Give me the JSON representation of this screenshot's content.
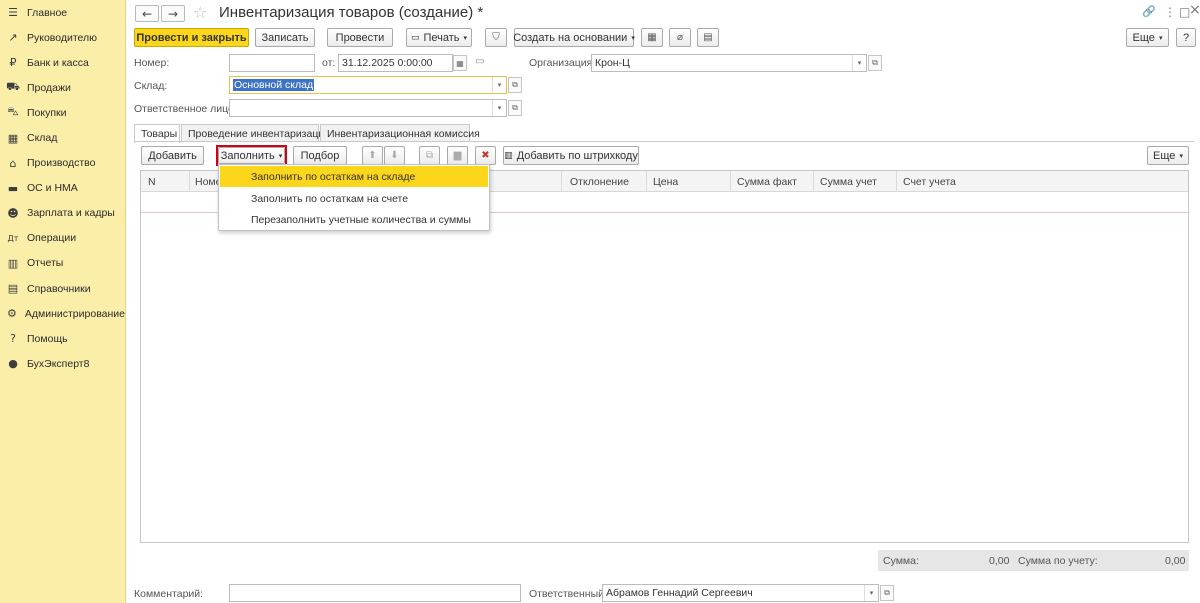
{
  "sidebar": {
    "items": [
      {
        "icon": "menu-icon",
        "glyph": "☰",
        "label": "Главное"
      },
      {
        "icon": "trend-icon",
        "glyph": "↗",
        "label": "Руководителю"
      },
      {
        "icon": "bank-icon",
        "glyph": "₽",
        "label": "Банк и касса"
      },
      {
        "icon": "cart-icon",
        "glyph": "⛟",
        "label": "Продажи"
      },
      {
        "icon": "basket-icon",
        "glyph": "⛍",
        "label": "Покупки"
      },
      {
        "icon": "warehouse-icon",
        "glyph": "▦",
        "label": "Склад"
      },
      {
        "icon": "factory-icon",
        "glyph": "⌂",
        "label": "Производство"
      },
      {
        "icon": "truck-icon",
        "glyph": "▬",
        "label": "ОС и НМА"
      },
      {
        "icon": "people-icon",
        "glyph": "☻",
        "label": "Зарплата и кадры"
      },
      {
        "icon": "operations-icon",
        "glyph": "Дт",
        "label": "Операции"
      },
      {
        "icon": "reports-icon",
        "glyph": "▥",
        "label": "Отчеты"
      },
      {
        "icon": "book-icon",
        "glyph": "▤",
        "label": "Справочники"
      },
      {
        "icon": "gear-icon",
        "glyph": "⚙",
        "label": "Администрирование"
      },
      {
        "icon": "help-icon",
        "glyph": "?",
        "label": "Помощь"
      },
      {
        "icon": "expert-icon",
        "glyph": "●",
        "label": "БухЭксперт8"
      }
    ]
  },
  "header": {
    "title": "Инвентаризация товаров (создание) *",
    "back_glyph": "←",
    "forward_glyph": "→",
    "star_glyph": "☆",
    "link_glyph": "🔗",
    "more_glyph": "⋮",
    "window_glyph": "□",
    "close_glyph": "×"
  },
  "toolbar": {
    "post_close": "Провести и закрыть",
    "save": "Записать",
    "post": "Провести",
    "print": "Печать",
    "create_based": "Создать на основании",
    "more": "Еще",
    "help": "?"
  },
  "form": {
    "number_label": "Номер:",
    "number_value": "",
    "date_label": "от:",
    "date_value": "31.12.2025  0:00:00",
    "org_label": "Организация:",
    "org_value": "Крон-Ц",
    "warehouse_label": "Склад:",
    "warehouse_value": "Основной склад",
    "responsible_label": "Ответственное лицо:",
    "responsible_value": ""
  },
  "tabs": [
    {
      "label": "Товары"
    },
    {
      "label": "Проведение инвентаризации"
    },
    {
      "label": "Инвентаризационная комиссия"
    }
  ],
  "grid_toolbar": {
    "add": "Добавить",
    "fill": "Заполнить",
    "select": "Подбор",
    "barcode": "Добавить по штрихкоду",
    "more": "Еще"
  },
  "grid": {
    "columns": [
      "N",
      "Номе",
      "Отклонение",
      "Цена",
      "Сумма факт",
      "Сумма учет",
      "Счет учета"
    ]
  },
  "fill_menu": {
    "items": [
      "Заполнить по остаткам на складе",
      "Заполнить по остаткам на счете",
      "Перезаполнить учетные количества и суммы"
    ]
  },
  "totals": {
    "sum_label": "Сумма:",
    "sum_value": "0,00",
    "sum_acc_label": "Сумма по учету:",
    "sum_acc_value": "0,00"
  },
  "bottom": {
    "comment_label": "Комментарий:",
    "comment_value": "",
    "resp_label": "Ответственный:",
    "resp_value": "Абрамов Геннадий Сергеевич"
  },
  "colors": {
    "sidebar_bg": "#fbeea9",
    "accent_yellow": "#fbd61b",
    "highlight_red": "#d0021b",
    "selection_blue": "#3c73c5"
  }
}
